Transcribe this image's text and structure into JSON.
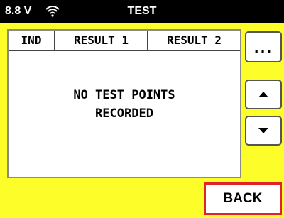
{
  "status_bar": {
    "voltage": "8.8 V",
    "title": "TEST",
    "wifi_icon": "wifi-icon"
  },
  "table": {
    "headers": [
      "IND",
      "RESULT 1",
      "RESULT 2"
    ],
    "empty_line1": "NO TEST POINTS",
    "empty_line2": "RECORDED"
  },
  "buttons": {
    "more_label": "...",
    "up_icon": "arrow-up-icon",
    "down_icon": "arrow-down-icon",
    "back_label": "BACK"
  },
  "colors": {
    "background": "#fdfd2a",
    "status_bar": "#000000",
    "back_border": "#e0232b"
  }
}
